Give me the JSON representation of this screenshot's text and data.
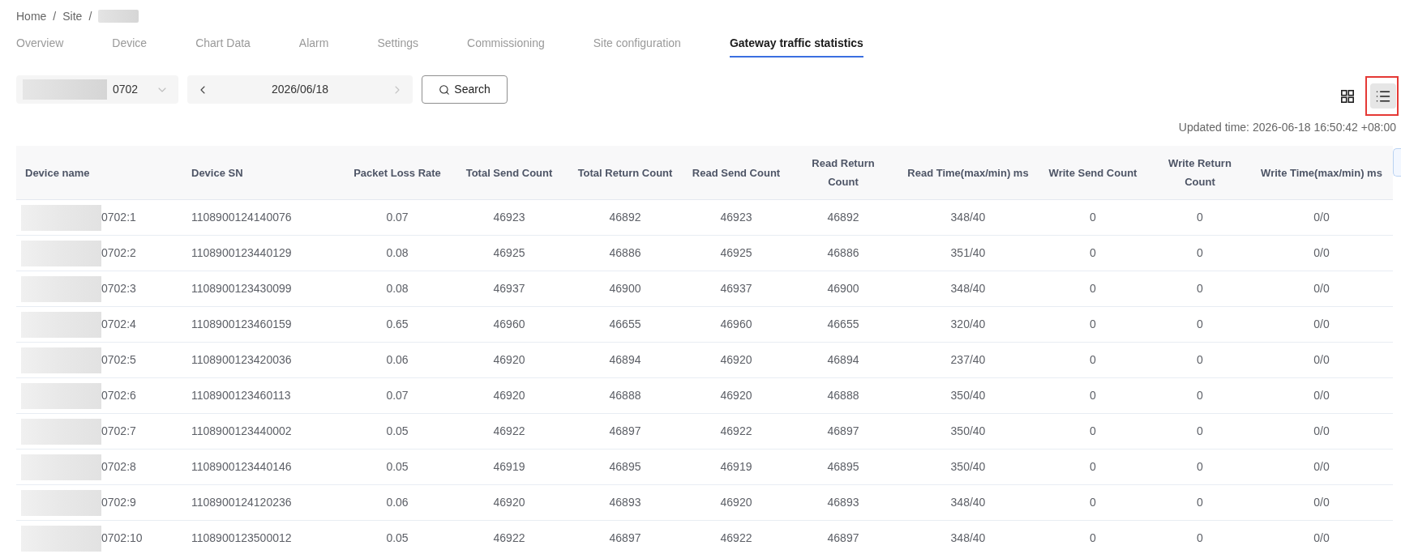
{
  "breadcrumb": [
    {
      "kind": "link",
      "label": "Home",
      "separator": "/"
    },
    {
      "kind": "link",
      "label": "Site",
      "separator": "/"
    },
    {
      "kind": "redacted"
    }
  ],
  "tabs": [
    {
      "label": "Overview",
      "selected": false
    },
    {
      "label": "Device",
      "selected": false
    },
    {
      "label": "Chart Data",
      "selected": false
    },
    {
      "label": "Alarm",
      "selected": false
    },
    {
      "label": "Settings",
      "selected": false
    },
    {
      "label": "Commissioning",
      "selected": false
    },
    {
      "label": "Site configuration",
      "selected": false
    },
    {
      "label": "Gateway traffic statistics",
      "selected": true
    }
  ],
  "device_select": {
    "value": "0702"
  },
  "date_picker": {
    "value": "2026/06/18",
    "prev_disabled": false,
    "next_disabled": true
  },
  "search_button": {
    "label": "Search"
  },
  "view_toggle": [
    {
      "kind": "grid",
      "selected": false,
      "highlighted": false
    },
    {
      "kind": "list",
      "selected": true,
      "highlighted": true
    }
  ],
  "updated_time": "Updated time: 2026-06-18 16:50:42 +08:00",
  "table": {
    "columns": [
      "Device name",
      "Device SN",
      "Packet Loss Rate",
      "Total Send Count",
      "Total Return Count",
      "Read Send Count",
      "Read Return Count",
      "Read Time(max/min) ms",
      "Write Send Count",
      "Write Return Count",
      "Write Time(max/min) ms"
    ],
    "rows": [
      [
        "0702:1",
        "1108900124140076",
        "0.07",
        "46923",
        "46892",
        "46923",
        "46892",
        "348/40",
        "0",
        "0",
        "0/0"
      ],
      [
        "0702:2",
        "1108900123440129",
        "0.08",
        "46925",
        "46886",
        "46925",
        "46886",
        "351/40",
        "0",
        "0",
        "0/0"
      ],
      [
        "0702:3",
        "1108900123430099",
        "0.08",
        "46937",
        "46900",
        "46937",
        "46900",
        "348/40",
        "0",
        "0",
        "0/0"
      ],
      [
        "0702:4",
        "1108900123460159",
        "0.65",
        "46960",
        "46655",
        "46960",
        "46655",
        "320/40",
        "0",
        "0",
        "0/0"
      ],
      [
        "0702:5",
        "1108900123420036",
        "0.06",
        "46920",
        "46894",
        "46920",
        "46894",
        "237/40",
        "0",
        "0",
        "0/0"
      ],
      [
        "0702:6",
        "1108900123460113",
        "0.07",
        "46920",
        "46888",
        "46920",
        "46888",
        "350/40",
        "0",
        "0",
        "0/0"
      ],
      [
        "0702:7",
        "1108900123440002",
        "0.05",
        "46922",
        "46897",
        "46922",
        "46897",
        "350/40",
        "0",
        "0",
        "0/0"
      ],
      [
        "0702:8",
        "1108900123440146",
        "0.05",
        "46919",
        "46895",
        "46919",
        "46895",
        "350/40",
        "0",
        "0",
        "0/0"
      ],
      [
        "0702:9",
        "1108900124120236",
        "0.06",
        "46920",
        "46893",
        "46920",
        "46893",
        "348/40",
        "0",
        "0",
        "0/0"
      ],
      [
        "0702:10",
        "1108900123500012",
        "0.05",
        "46922",
        "46897",
        "46922",
        "46897",
        "348/40",
        "0",
        "0",
        "0/0"
      ]
    ]
  }
}
